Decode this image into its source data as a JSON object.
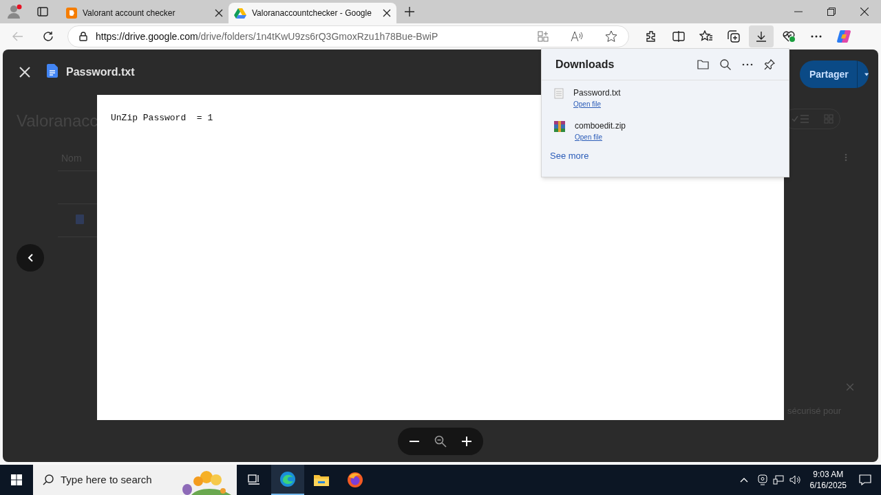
{
  "browser": {
    "tabs": [
      {
        "title": "Valorant account checker",
        "kind": "blog",
        "selected": false
      },
      {
        "title": "Valoranaccountchecker - Google",
        "kind": "drive",
        "selected": true
      }
    ],
    "url_host": "https://drive.google.com",
    "url_path": "/drive/folders/1n4tKwU9zs6rQ3GmoxRzu1h78Bue-BwiP"
  },
  "drive": {
    "folder_title": "Valoranacc",
    "column_header": "Nom",
    "share_button": "Partager",
    "toast_text": "sécurisé pour"
  },
  "viewer": {
    "file_name": "Password.txt",
    "content": "UnZip Password  = 1"
  },
  "downloads": {
    "title": "Downloads",
    "items": [
      {
        "kind": "text",
        "file_name": "Password.txt",
        "action": "Open file"
      },
      {
        "kind": "archive",
        "file_name": "comboedit.zip",
        "action": "Open file"
      }
    ],
    "see_more": "See more"
  },
  "taskbar": {
    "search_placeholder": "Type here to search",
    "time": "9:03 AM",
    "date": "6/16/2025"
  }
}
